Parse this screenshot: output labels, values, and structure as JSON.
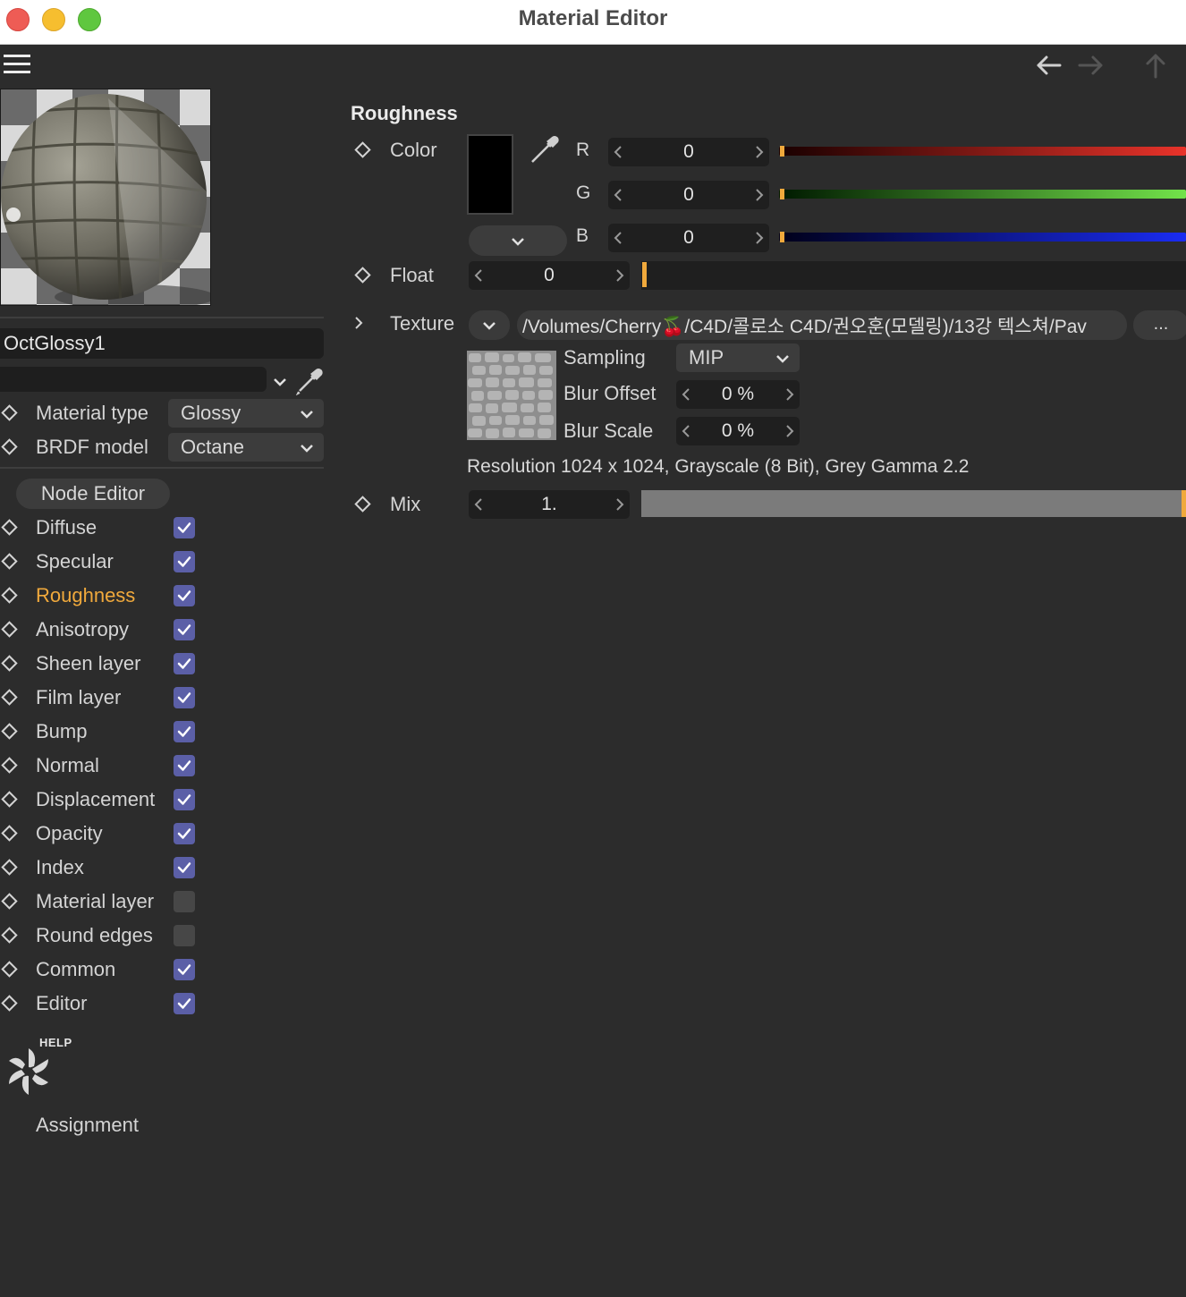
{
  "window": {
    "title": "Material Editor"
  },
  "material": {
    "name": "OctGlossy1",
    "material_type_label": "Material type",
    "material_type_value": "Glossy",
    "brdf_label": "BRDF model",
    "brdf_value": "Octane"
  },
  "sidebar": {
    "node_editor_label": "Node Editor",
    "channels": [
      {
        "label": "Diffuse",
        "checked": true,
        "active": false
      },
      {
        "label": "Specular",
        "checked": true,
        "active": false
      },
      {
        "label": "Roughness",
        "checked": true,
        "active": true
      },
      {
        "label": "Anisotropy",
        "checked": true,
        "active": false
      },
      {
        "label": "Sheen layer",
        "checked": true,
        "active": false
      },
      {
        "label": "Film layer",
        "checked": true,
        "active": false
      },
      {
        "label": "Bump",
        "checked": true,
        "active": false
      },
      {
        "label": "Normal",
        "checked": true,
        "active": false
      },
      {
        "label": "Displacement",
        "checked": true,
        "active": false
      },
      {
        "label": "Opacity",
        "checked": true,
        "active": false
      },
      {
        "label": "Index",
        "checked": true,
        "active": false
      },
      {
        "label": "Material layer",
        "checked": false,
        "active": false
      },
      {
        "label": "Round edges",
        "checked": false,
        "active": false
      },
      {
        "label": "Common",
        "checked": true,
        "active": false
      },
      {
        "label": "Editor",
        "checked": true,
        "active": false
      }
    ],
    "help_label": "HELP",
    "assignment_label": "Assignment"
  },
  "panel": {
    "section_title": "Roughness",
    "color_label": "Color",
    "channels": {
      "r_label": "R",
      "r_value": "0",
      "g_label": "G",
      "g_value": "0",
      "b_label": "B",
      "b_value": "0"
    },
    "float_label": "Float",
    "float_value": "0",
    "texture_label": "Texture",
    "texture_path": "/Volumes/Cherry🍒/C4D/콜로소 C4D/권오훈(모델링)/13강 텍스쳐/Pav",
    "more_label": "...",
    "sampling_label": "Sampling",
    "sampling_value": "MIP",
    "blur_offset_label": "Blur Offset",
    "blur_offset_value": "0 %",
    "blur_scale_label": "Blur Scale",
    "blur_scale_value": "0 %",
    "resolution_text": "Resolution 1024 x 1024, Grayscale (8 Bit), Grey Gamma 2.2",
    "mix_label": "Mix",
    "mix_value": "1."
  },
  "colors": {
    "accent": "#f0a93c",
    "checkbox_on": "#5b5fa7",
    "background": "#2c2c2c"
  },
  "icons": [
    "menu-icon",
    "back-arrow-icon",
    "forward-arrow-icon",
    "up-arrow-icon",
    "eyedropper-icon",
    "chevron-down-icon",
    "keyframe-diamond-icon",
    "checkmark-icon",
    "octane-help-icon"
  ]
}
